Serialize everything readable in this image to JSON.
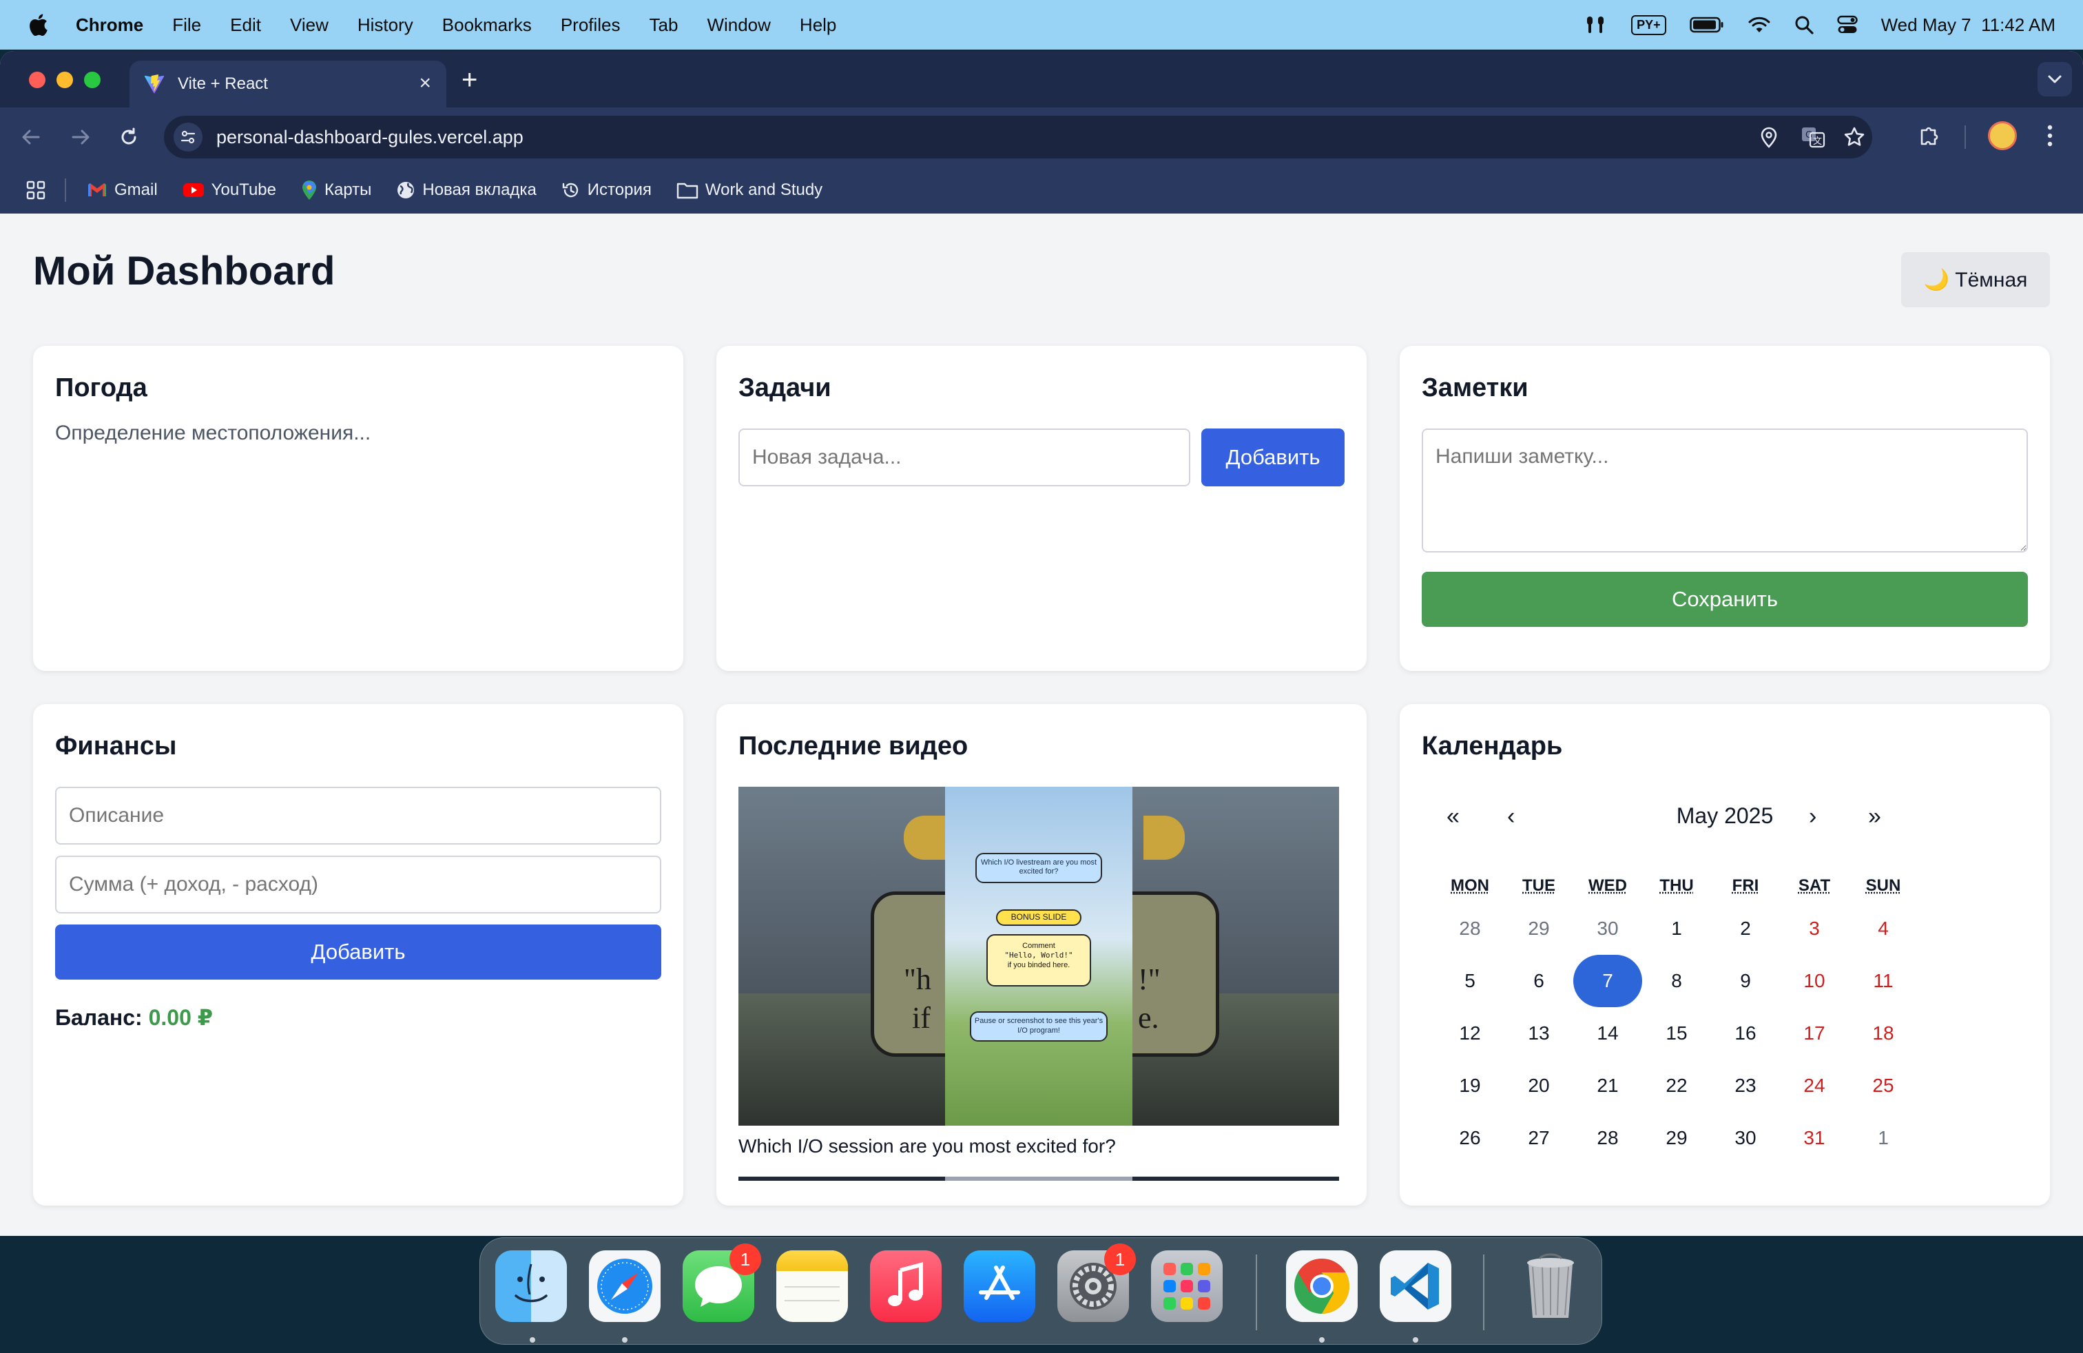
{
  "menubar": {
    "app": "Chrome",
    "items": [
      "File",
      "Edit",
      "View",
      "History",
      "Bookmarks",
      "Profiles",
      "Tab",
      "Window",
      "Help"
    ],
    "input_source": "PY+",
    "clock": "Wed May 7  11:42 AM"
  },
  "browser": {
    "tab_title": "Vite + React",
    "url": "personal-dashboard-gules.vercel.app",
    "bookmarks": [
      "Gmail",
      "YouTube",
      "Карты",
      "Новая вкладка",
      "История",
      "Work and Study"
    ]
  },
  "page": {
    "title": "Мой Dashboard",
    "theme_button": "🌙 Тёмная"
  },
  "weather": {
    "title": "Погода",
    "status": "Определение местоположения..."
  },
  "tasks": {
    "title": "Задачи",
    "input_placeholder": "Новая задача...",
    "add_label": "Добавить"
  },
  "notes": {
    "title": "Заметки",
    "placeholder": "Напиши заметку...",
    "save_label": "Сохранить"
  },
  "finance": {
    "title": "Финансы",
    "desc_placeholder": "Описание",
    "amount_placeholder": "Сумма (+ доход, - расход)",
    "add_label": "Добавить",
    "balance_label": "Баланс:",
    "balance_value": "0.00 ₽",
    "balance_color": "#3c9a4a"
  },
  "videos": {
    "title": "Последние видео",
    "video_caption": "Which I/O session are you most excited for?",
    "overlay_question": "Which I/O livestream are you most excited for?",
    "bonus": "BONUS SLIDE",
    "comment_label": "Comment",
    "comment_code": "\"Hello, World!\"",
    "comment_note": "if you binded here.",
    "footer_note": "Pause or screenshot to see this year's I/O program!",
    "bg_left": "\"h",
    "bg_left2": "if",
    "bg_right": "!\"",
    "bg_right2": "e."
  },
  "calendar": {
    "title": "Календарь",
    "month": "May 2025",
    "nav": {
      "prev_year": "«",
      "prev_month": "‹",
      "next_month": "›",
      "next_year": "»"
    },
    "weekdays": [
      "MON",
      "TUE",
      "WED",
      "THU",
      "FRI",
      "SAT",
      "SUN"
    ],
    "weeks": [
      [
        "28",
        "29",
        "30",
        "1",
        "2",
        "3",
        "4"
      ],
      [
        "5",
        "6",
        "7",
        "8",
        "9",
        "10",
        "11"
      ],
      [
        "12",
        "13",
        "14",
        "15",
        "16",
        "17",
        "18"
      ],
      [
        "19",
        "20",
        "21",
        "22",
        "23",
        "24",
        "25"
      ],
      [
        "26",
        "27",
        "28",
        "29",
        "30",
        "31",
        "1"
      ]
    ],
    "today": "7",
    "accent": "#2d66d8",
    "weekend_color": "#cc1f1f"
  },
  "dock": {
    "apps": [
      "Finder",
      "Safari",
      "Messages",
      "Notes",
      "Music",
      "App Store",
      "System Settings",
      "Launchpad",
      "Chrome",
      "VS Code",
      "Trash"
    ],
    "badges": {
      "messages": "1",
      "settings": "1"
    }
  }
}
